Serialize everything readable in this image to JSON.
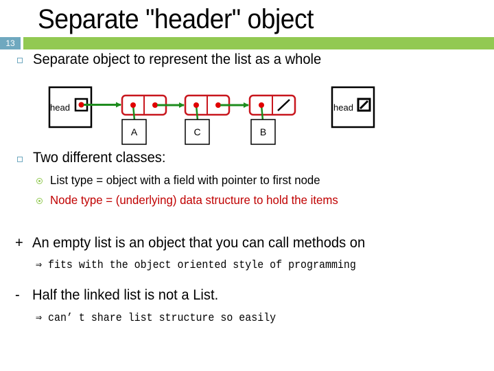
{
  "slide": {
    "title": "Separate \"header\" object",
    "number": "13"
  },
  "colors": {
    "accent_bar": "#92c952",
    "slide_number_bg": "#6fa8bf",
    "node_border": "#c8161d",
    "pointer_dot": "#e00000",
    "arrow": "#1e8c1e",
    "emphasis_text": "#c00000"
  },
  "bullets": [
    {
      "icon": "square-bullet-icon",
      "text": "Separate object to represent the list as a whole"
    },
    {
      "icon": "square-bullet-icon",
      "text": "Two different classes:",
      "sub": [
        {
          "icon": "circle-bullet-icon",
          "text": "List type = object with a field with pointer to first node",
          "emphasis": false
        },
        {
          "icon": "circle-bullet-icon",
          "text": "Node type = (underlying) data structure to hold the items",
          "emphasis": true
        }
      ]
    }
  ],
  "diagram": {
    "left_header": {
      "label": "head",
      "pointer": "non-null"
    },
    "nodes": [
      {
        "value": "A",
        "next": "pointer"
      },
      {
        "value": "C",
        "next": "pointer"
      },
      {
        "value": "B",
        "next": "null"
      }
    ],
    "right_header": {
      "label": "head",
      "pointer": "null"
    }
  },
  "pros_cons": [
    {
      "sign": "+",
      "text": "An empty list is an object that you can call methods on",
      "note": "⇒ fits with the object oriented style of programming"
    },
    {
      "sign": "-",
      "text": "Half the linked list is not a List.",
      "note": "⇒ can’ t share list structure so easily"
    }
  ]
}
